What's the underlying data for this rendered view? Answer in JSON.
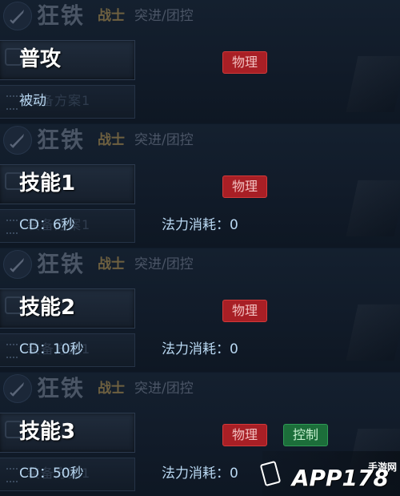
{
  "hero": {
    "name": "狂铁",
    "class": "战士",
    "roles": "突进/团控"
  },
  "panels": [
    {
      "skill": "普攻",
      "tags": [
        "物理"
      ],
      "sub_label": "被动",
      "sub_ghost": "装备方案1",
      "mana": ""
    },
    {
      "skill": "技能1",
      "tags": [
        "物理"
      ],
      "sub_label": "CD：6秒",
      "sub_ghost": "装备方案1",
      "mana": "法力消耗：0"
    },
    {
      "skill": "技能2",
      "tags": [
        "物理"
      ],
      "sub_label": "CD：10秒",
      "sub_ghost": "装备方案1",
      "mana": "法力消耗：0"
    },
    {
      "skill": "技能3",
      "tags": [
        "物理",
        "控制"
      ],
      "sub_label": "CD：50秒",
      "sub_ghost": "装备方案1",
      "mana": "法力消耗：0"
    }
  ],
  "watermark": {
    "text": "APP178",
    "sub": "手游网"
  },
  "colors": {
    "physical_tag": "#a81f25",
    "control_tag": "#1c6e3a",
    "info_text": "#b9d8f2"
  }
}
